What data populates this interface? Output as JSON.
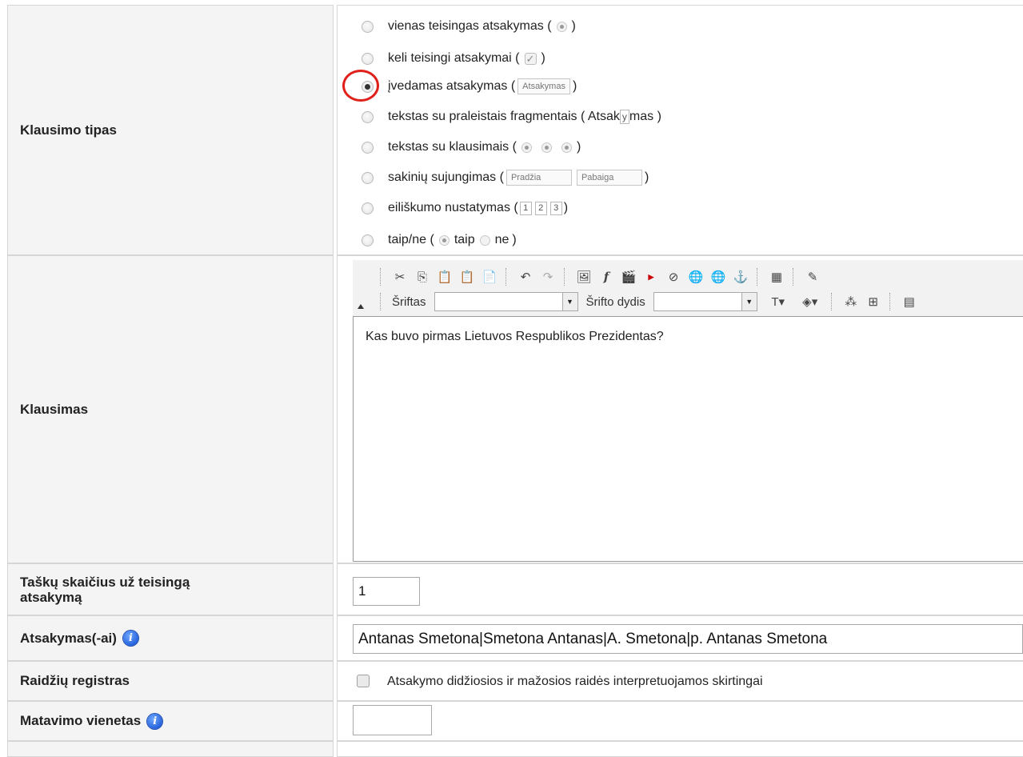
{
  "question_type": {
    "label": "Klausimo tipas",
    "options": [
      {
        "text": "vienas teisingas atsakymas (",
        "tail": ")"
      },
      {
        "text": "keli teisingi atsakymai (",
        "tail": ")"
      },
      {
        "text": "įvedamas atsakymas (",
        "sample": "Atsakymas",
        "tail": ")"
      },
      {
        "text": "tekstas su praleistais fragmentais ( Atsak",
        "hl": "y",
        "after": "mas )"
      },
      {
        "text": "tekstas su klausimais (",
        "tail": ")"
      },
      {
        "text": "sakinių sujungimas (",
        "s1": "Pradžia",
        "s2": "Pabaiga",
        "tail": ")"
      },
      {
        "text": "eiliškumo nustatymas (",
        "n": [
          "1",
          "2",
          "3"
        ],
        "tail": ")"
      },
      {
        "text": "taip/ne (",
        "yes": "taip",
        "no": "ne",
        "tail": ")"
      }
    ],
    "selected_index": 2
  },
  "question": {
    "label": "Klausimas",
    "toolbar": {
      "font_label": "Šriftas",
      "size_label": "Šrifto dydis"
    },
    "content": "Kas buvo pirmas Lietuvos Respublikos Prezidentas?"
  },
  "points": {
    "label": "Taškų skaičius už teisingą atsakymą",
    "value": "1"
  },
  "answers": {
    "label": "Atsakymas(-ai)",
    "value": "Antanas Smetona|Smetona Antanas|A. Smetona|p. Antanas Smetona"
  },
  "case": {
    "label": "Raidžių registras",
    "checkbox_label": "Atsakymo didžiosios ir mažosios raidės interpretuojamos skirtingai"
  },
  "unit": {
    "label": "Matavimo vienetas",
    "value": ""
  },
  "icons": {
    "info": "info-icon"
  }
}
